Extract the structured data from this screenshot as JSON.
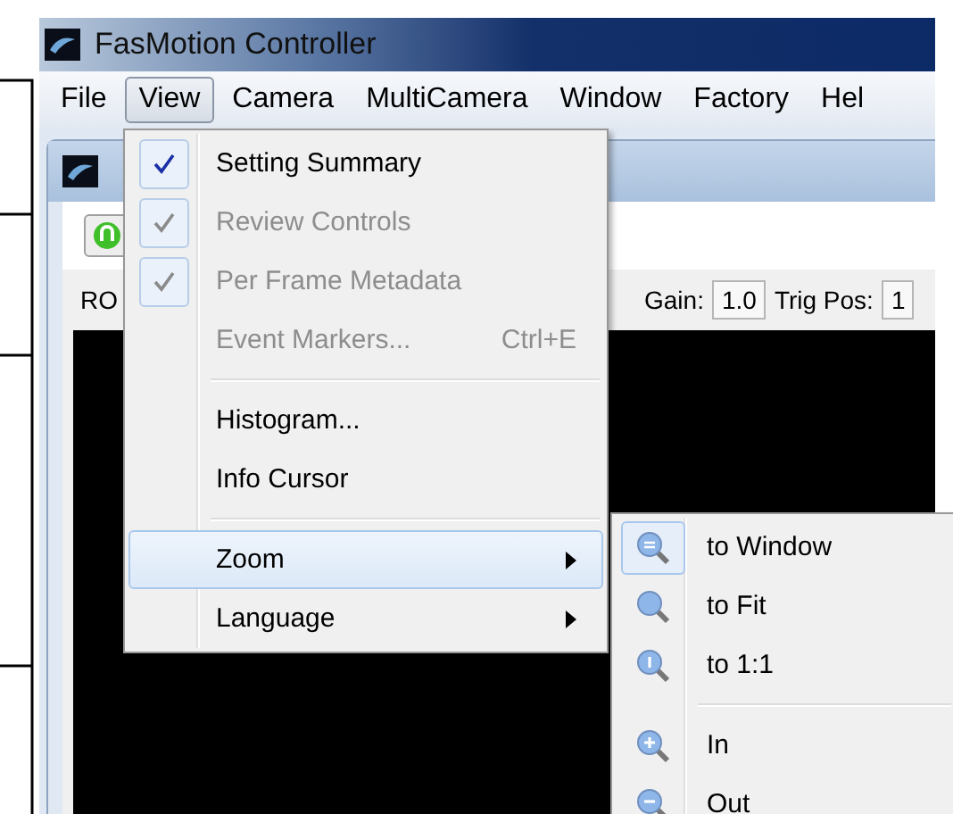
{
  "window": {
    "title": "FasMotion Controller"
  },
  "menubar": [
    {
      "label": "File",
      "selected": false
    },
    {
      "label": "View",
      "selected": true
    },
    {
      "label": "Camera",
      "selected": false
    },
    {
      "label": "MultiCamera",
      "selected": false
    },
    {
      "label": "Window",
      "selected": false
    },
    {
      "label": "Factory",
      "selected": false
    },
    {
      "label": "Hel",
      "selected": false
    }
  ],
  "view_menu": [
    {
      "kind": "check",
      "label": "Setting Summary",
      "checked": true,
      "disabled": false
    },
    {
      "kind": "check",
      "label": "Review Controls",
      "checked": true,
      "disabled": true
    },
    {
      "kind": "check",
      "label": "Per Frame Metadata",
      "checked": true,
      "disabled": true
    },
    {
      "kind": "item",
      "label": "Event Markers...",
      "shortcut": "Ctrl+E",
      "disabled": true
    },
    {
      "kind": "separator"
    },
    {
      "kind": "item",
      "label": "Histogram...",
      "disabled": false
    },
    {
      "kind": "item",
      "label": "Info Cursor",
      "disabled": false
    },
    {
      "kind": "separator"
    },
    {
      "kind": "submenu",
      "label": "Zoom",
      "selected": true
    },
    {
      "kind": "submenu",
      "label": "Language",
      "selected": false
    }
  ],
  "zoom_menu": [
    {
      "kind": "window",
      "label": "to Window",
      "selected": true
    },
    {
      "kind": "fit",
      "label": "to Fit",
      "selected": false
    },
    {
      "kind": "actual",
      "label": "to 1:1",
      "selected": false
    },
    {
      "kind": "separator"
    },
    {
      "kind": "in",
      "label": "In",
      "selected": false
    },
    {
      "kind": "out",
      "label": "Out",
      "selected": false
    }
  ],
  "settings_row": {
    "roi_label": "RO",
    "gain_label": "Gain:",
    "gain_value": "1.0",
    "trig_label": "Trig Pos:",
    "trig_value": "1"
  }
}
